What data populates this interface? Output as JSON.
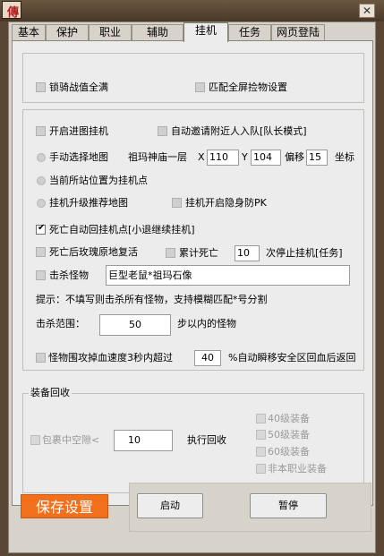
{
  "window": {
    "logo_char": "傳",
    "close_label": "✕"
  },
  "tabs": [
    {
      "label": "基本"
    },
    {
      "label": "保护"
    },
    {
      "label": "职业"
    },
    {
      "label": "辅助"
    },
    {
      "label": "挂机"
    },
    {
      "label": "任务"
    },
    {
      "label": "网页登陆"
    }
  ],
  "top": {
    "mount_label": "锁骑战值全满",
    "pickup_label": "匹配全屏捡物设置"
  },
  "hang": {
    "enter_map_label": "开启进图挂机",
    "auto_invite_label": "自动邀请附近人入队[队长模式]",
    "manual_map_label": "手动选择地图",
    "map_name": "祖玛神庙一层",
    "x_label": "X",
    "x_value": "110",
    "y_label": "Y",
    "y_value": "104",
    "offset_label": "偏移",
    "offset_value": "15",
    "coord_label": "坐标",
    "current_point_label": "当前所站位置为挂机点",
    "upgrade_map_label": "挂机升级推荐地图",
    "stealth_label": "挂机开启隐身防PK",
    "death_return_label": "死亡自动回挂机点[小退继续挂机]",
    "rose_revive_label": "死亡后玫瑰原地复活",
    "cumulative_death_label": "累计死亡",
    "death_count": "10",
    "stop_hang_label": "次停止挂机[任务]",
    "kill_monster_label": "击杀怪物",
    "monster_list": "巨型老鼠*祖玛石像",
    "hint_text": "提示：不填写则击杀所有怪物，支持模糊匹配*号分割",
    "kill_range_label": "击杀范围：",
    "kill_range_value": "50",
    "kill_range_suffix": "步以内的怪物",
    "hp_drop_label": "怪物围攻掉血速度3秒内超过",
    "hp_drop_value": "40",
    "hp_drop_suffix": "%自动瞬移安全区回血后返回"
  },
  "recycle": {
    "title": "装备回收",
    "bag_space_label": "包裹中空隙<",
    "bag_space_value": "10",
    "execute_label": "执行回收",
    "lv40_label": "40级装备",
    "lv50_label": "50级装备",
    "lv60_label": "60级装备",
    "non_class_label": "非本职业装备"
  },
  "footer": {
    "save_label": "保存设置",
    "start_label": "启动",
    "pause_label": "暂停"
  }
}
